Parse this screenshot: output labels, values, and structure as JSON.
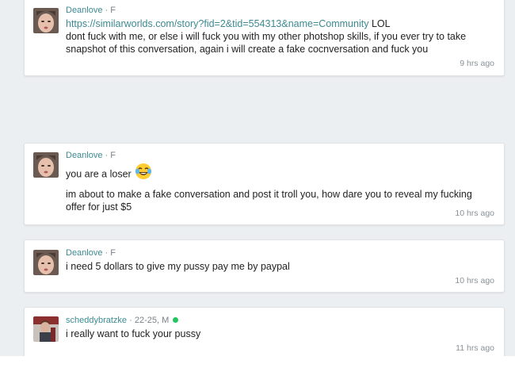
{
  "posts": [
    {
      "user": "Deanlove",
      "sep": " · ",
      "gender": "F",
      "link": "https://similarworlds.com/story?fid=2&tid=554313&name=Community",
      "link_suffix": " LOL",
      "line2": "dont fuck with me, or else i will fuck you with my other photshop skills, if you ever try to take snapshot of this conversation, again i will create a fake cocnversation and fuck you",
      "time": "9 hrs ago"
    },
    {
      "user": "Deanlove",
      "sep": " · ",
      "gender": "F",
      "line1": "you are a loser",
      "emoji": "laughing-tears-emoji",
      "line2": "im about to make a fake conversation and post it troll you, how dare you to reveal my fucking offer for just $5",
      "time": "10 hrs ago"
    },
    {
      "user": "Deanlove",
      "sep": " · ",
      "gender": "F",
      "line1": "i need 5 dollars to give my pussy pay me by paypal",
      "time": "10 hrs ago"
    },
    {
      "user": "scheddybratzke",
      "sep": " · ",
      "gender": "22-25, M",
      "online": true,
      "line1": "i really want to fuck your pussy",
      "time": "11 hrs ago"
    }
  ],
  "colors": {
    "username": "#3d8a91",
    "online": "#22c55e",
    "background": "#eceff1"
  }
}
